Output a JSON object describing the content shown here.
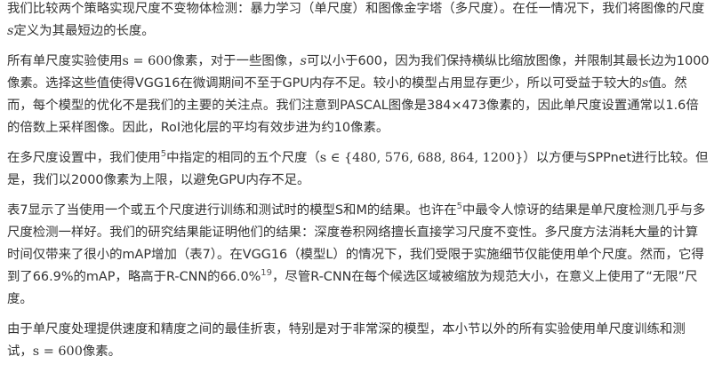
{
  "paragraphs": [
    {
      "segments": [
        {
          "type": "text",
          "text": "我们比较两个策略实现尺度不变物体检测：暴力学习（单尺度）和图像金字塔（多尺度）。在任一情况下，我们将图像的尺度"
        },
        {
          "type": "math",
          "text": "s"
        },
        {
          "type": "text",
          "text": "定义为其最短边的长度。"
        }
      ]
    },
    {
      "segments": [
        {
          "type": "text",
          "text": "所有单尺度实验使用"
        },
        {
          "type": "math",
          "text": "s = 600"
        },
        {
          "type": "text",
          "text": "像素，对于一些图像，"
        },
        {
          "type": "math",
          "text": "s"
        },
        {
          "type": "text",
          "text": "可以小于600，因为我们保持横纵比缩放图像，并限制其最长边为1000像素。选择这些值使得VGG16在微调期间不至于GPU内存不足。较小的模型占用显存更少，所以可受益于较大的"
        },
        {
          "type": "math",
          "text": "s"
        },
        {
          "type": "text",
          "text": "值。然而，每个模型的优化不是我们的主要的关注点。我们注意到PASCAL图像是384×473像素的，因此单尺度设置通常以1.6倍的倍数上采样图像。因此，RoI池化层的平均有效步进为约10像素。"
        }
      ]
    },
    {
      "segments": [
        {
          "type": "text",
          "text": "在多尺度设置中，我们使用"
        },
        {
          "type": "sup",
          "text": "5"
        },
        {
          "type": "text",
          "text": "中指定的相同的五个尺度（"
        },
        {
          "type": "math",
          "text": "s ∈ {480, 576, 688, 864, 1200}"
        },
        {
          "type": "text",
          "text": "）以方便与SPPnet进行比较。但是，我们以2000像素为上限，以避免GPU内存不足。"
        }
      ]
    },
    {
      "segments": [
        {
          "type": "text",
          "text": "表7显示了当使用一个或五个尺度进行训练和测试时的模型S和M的结果。也许在"
        },
        {
          "type": "sup",
          "text": "5"
        },
        {
          "type": "text",
          "text": "中最令人惊讶的结果是单尺度检测几乎与多尺度检测一样好。我们的研究结果能证明他们的结果：深度卷积网络擅长直接学习尺度不变性。多尺度方法消耗大量的计算时间仅带来了很小的mAP增加（表7）。在VGG16（模型L）的情况下，我们受限于实施细节仅能使用单个尺度。然而，它得到了66.9%的mAP，略高于R-CNN的66.0%"
        },
        {
          "type": "sup",
          "text": "19"
        },
        {
          "type": "text",
          "text": "，尽管R-CNN在每个候选区域被缩放为规范大小，在意义上使用了“无限”尺度。"
        }
      ]
    },
    {
      "segments": [
        {
          "type": "text",
          "text": "由于单尺度处理提供速度和精度之间的最佳折衷，特别是对于非常深的模型，本小节以外的所有实验使用单尺度训练和测试，"
        },
        {
          "type": "math",
          "text": "s = 600"
        },
        {
          "type": "text",
          "text": "像素。"
        }
      ]
    }
  ]
}
